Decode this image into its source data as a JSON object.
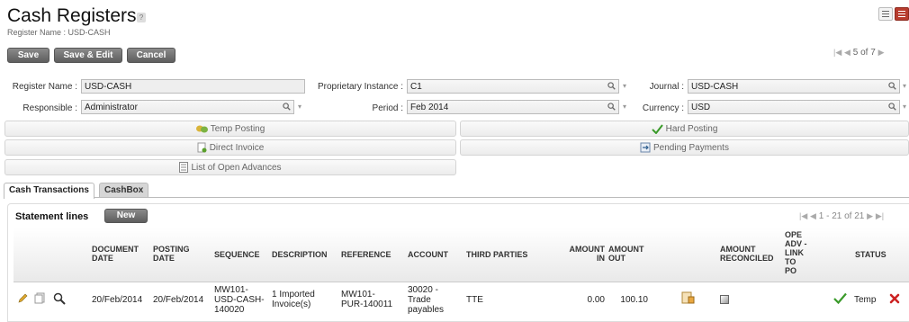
{
  "header": {
    "title": "Cash Registers",
    "subtitle": "Register Name : USD-CASH",
    "help": "?"
  },
  "toolbar": {
    "save": "Save",
    "save_edit": "Save & Edit",
    "cancel": "Cancel"
  },
  "pager": {
    "text": "5 of 7"
  },
  "form": {
    "register_name_label": "Register Name :",
    "register_name": "USD-CASH",
    "proprietary_label": "Proprietary Instance :",
    "proprietary": "C1",
    "journal_label": "Journal :",
    "journal": "USD-CASH",
    "responsible_label": "Responsible :",
    "responsible": "Administrator",
    "period_label": "Period :",
    "period": "Feb 2014",
    "currency_label": "Currency :",
    "currency": "USD"
  },
  "actions": {
    "temp_posting": "Temp Posting",
    "hard_posting": "Hard Posting",
    "direct_invoice": "Direct Invoice",
    "pending_payments": "Pending Payments",
    "open_advances": "List of Open Advances"
  },
  "tabs": {
    "cash_transactions": "Cash Transactions",
    "cashbox": "CashBox"
  },
  "statement": {
    "title": "Statement lines",
    "new_button": "New",
    "pager": "1 - 21 of 21",
    "columns": {
      "document_date": [
        "DOCUMENT",
        "DATE"
      ],
      "posting_date": [
        "POSTING",
        "DATE"
      ],
      "sequence": "SEQUENCE",
      "description": "DESCRIPTION",
      "reference": "REFERENCE",
      "account": "ACCOUNT",
      "third_parties": "THIRD PARTIES",
      "amount_in": [
        "AMOUNT",
        "IN"
      ],
      "amount_out": [
        "AMOUNT",
        "OUT"
      ],
      "amount_reconciled": [
        "AMOUNT",
        "RECONCILED"
      ],
      "ope_adv": [
        "OPE",
        "ADV -",
        "LINK",
        "TO",
        "PO"
      ],
      "status": "STATUS"
    },
    "row": {
      "document_date": "20/Feb/2014",
      "posting_date": "20/Feb/2014",
      "sequence": [
        "MW101-",
        "USD-CASH-",
        "140020"
      ],
      "description": [
        "1 Imported",
        "Invoice(s)"
      ],
      "reference": [
        "MW101-",
        "PUR-140011"
      ],
      "account": [
        "30020 -",
        "Trade",
        "payables"
      ],
      "third_parties": "TTE",
      "amount_in": "0.00",
      "amount_out": "100.10",
      "status": "Temp"
    }
  },
  "colors": {
    "accent": "#b83c2e",
    "button_dark": "#6e6e6e",
    "check_green": "#3a9a2a",
    "delete_red": "#cc2222"
  }
}
